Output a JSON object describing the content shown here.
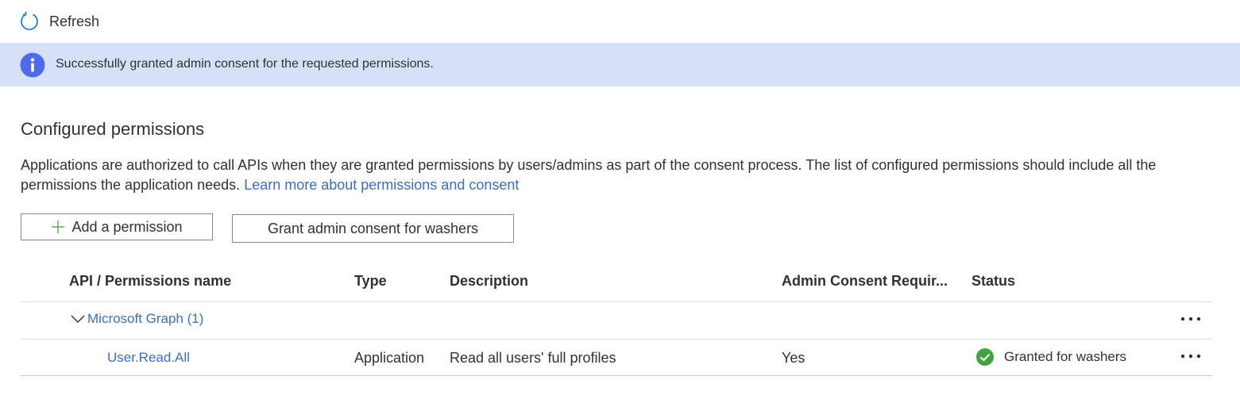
{
  "toolbar": {
    "refresh_label": "Refresh"
  },
  "banner": {
    "message": "Successfully granted admin consent for the requested permissions."
  },
  "section": {
    "title": "Configured permissions",
    "description": "Applications are authorized to call APIs when they are granted permissions by users/admins as part of the consent process. The list of configured permissions should include all the permissions the application needs.",
    "learn_more": "Learn more about permissions and consent"
  },
  "actions": {
    "add_permission": "Add a permission",
    "grant_consent": "Grant admin consent for washers"
  },
  "table": {
    "headers": [
      "API / Permissions name",
      "Type",
      "Description",
      "Admin Consent Requir...",
      "Status"
    ],
    "groups": [
      {
        "name": "Microsoft Graph (1)",
        "rows": [
          {
            "name": "User.Read.All",
            "type": "Application",
            "description": "Read all users' full profiles",
            "admin_consent": "Yes",
            "status": "Granted for washers"
          }
        ]
      }
    ]
  },
  "colors": {
    "link": "#3a6fc4",
    "banner_bg": "#d4e1f9",
    "info_icon": "#4f6bed",
    "success": "#3fa33f"
  }
}
